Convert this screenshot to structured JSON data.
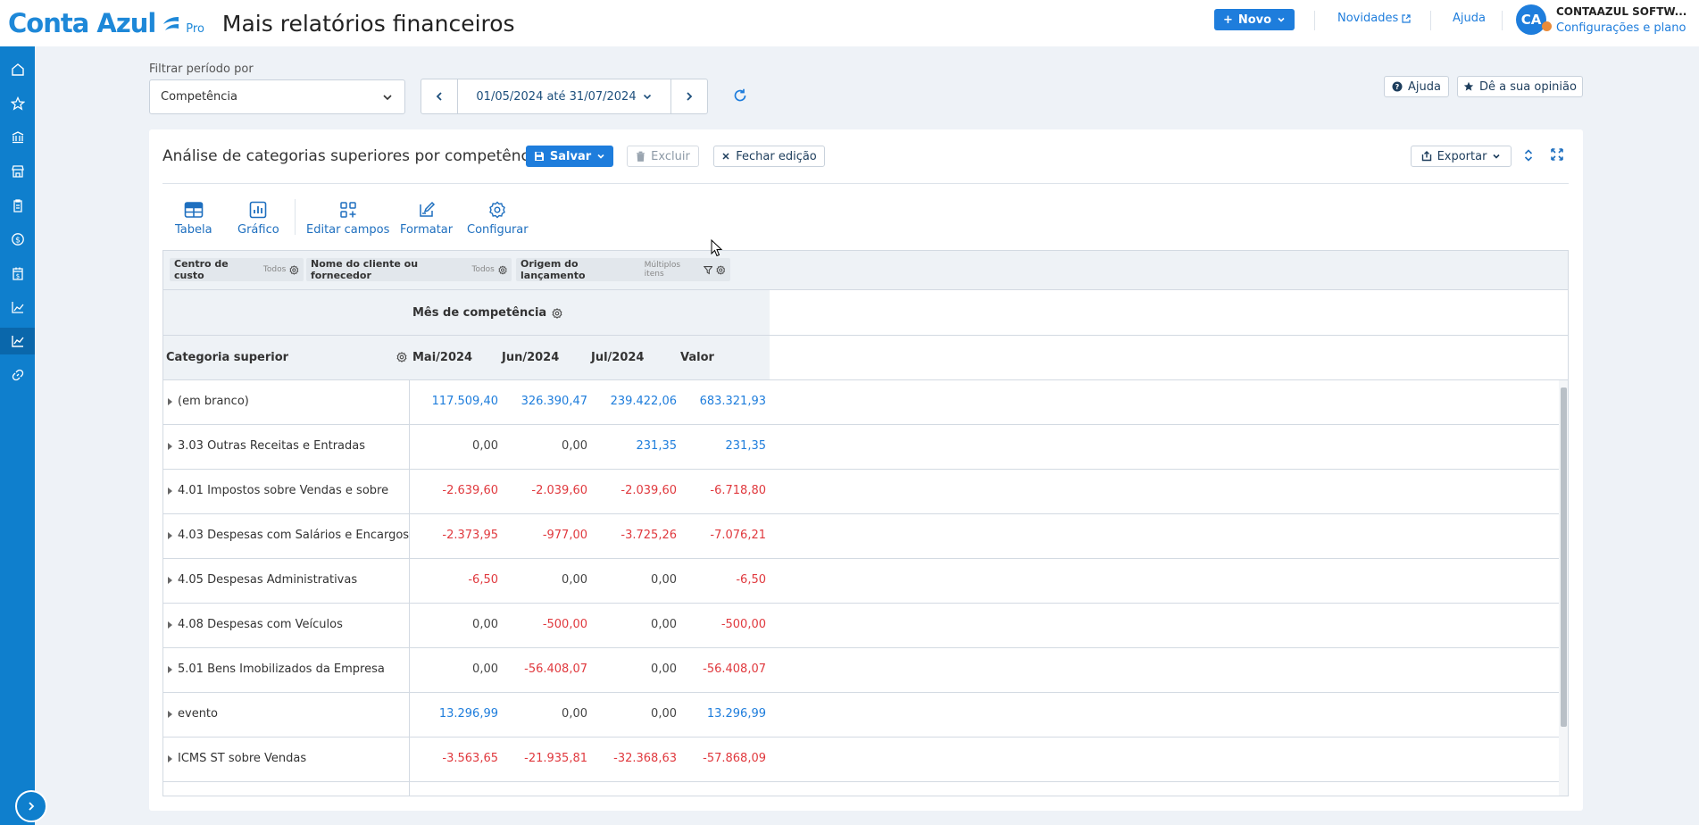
{
  "app": {
    "logo_text": "Conta Azul",
    "logo_badge": "Pro",
    "page_title": "Mais relatórios financeiros"
  },
  "topbar": {
    "new_label": "Novo",
    "news_label": "Novidades",
    "help_label": "Ajuda",
    "avatar_initials": "CA",
    "company_name": "CONTAAZUL SOFTW...",
    "config_label": "Configurações e plano"
  },
  "sidebar": {
    "items": [
      "home-icon",
      "star-icon",
      "bank-icon",
      "store-icon",
      "clipboard-icon",
      "money-icon",
      "calendar-money-icon",
      "report-icon",
      "chart-icon",
      "link-icon"
    ],
    "active_item": "chart-icon"
  },
  "filters": {
    "period_label": "Filtrar período por",
    "period_type": "Competência",
    "date_range": "01/05/2024 até 31/07/2024",
    "help_button": "Ajuda",
    "feedback_button": "Dê a sua opinião"
  },
  "report": {
    "title": "Análise de categorias superiores por competência",
    "save_label": "Salvar",
    "delete_label": "Excluir",
    "close_edit_label": "Fechar edição",
    "export_label": "Exportar",
    "tools": [
      "Tabela",
      "Gráfico",
      "Editar campos",
      "Formatar",
      "Configurar"
    ],
    "filter_chips": [
      {
        "name": "Centro de custo",
        "value": "Todos"
      },
      {
        "name": "Nome do cliente ou fornecedor",
        "value": "Todos"
      },
      {
        "name": "Origem do lançamento",
        "value": "Múltiplos itens"
      }
    ],
    "column_group_header": "Mês de competência",
    "row_header": "Categoria superior",
    "columns": [
      "Mai/2024",
      "Jun/2024",
      "Jul/2024",
      "Valor"
    ],
    "rows": [
      {
        "category": "(em branco)",
        "values": [
          "117.509,40",
          "326.390,47",
          "239.422,06",
          "683.321,93"
        ]
      },
      {
        "category": "3.03 Outras Receitas e Entradas",
        "values": [
          "0,00",
          "0,00",
          "231,35",
          "231,35"
        ]
      },
      {
        "category": "4.01 Impostos sobre Vendas e sobre",
        "values": [
          "-2.639,60",
          "-2.039,60",
          "-2.039,60",
          "-6.718,80"
        ]
      },
      {
        "category": "4.03 Despesas com Salários e Encargos",
        "values": [
          "-2.373,95",
          "-977,00",
          "-3.725,26",
          "-7.076,21"
        ]
      },
      {
        "category": "4.05 Despesas Administrativas",
        "values": [
          "-6,50",
          "0,00",
          "0,00",
          "-6,50"
        ]
      },
      {
        "category": "4.08 Despesas com Veículos",
        "values": [
          "0,00",
          "-500,00",
          "0,00",
          "-500,00"
        ]
      },
      {
        "category": "5.01 Bens Imobilizados da Empresa",
        "values": [
          "0,00",
          "-56.408,07",
          "0,00",
          "-56.408,07"
        ]
      },
      {
        "category": "evento",
        "values": [
          "13.296,99",
          "0,00",
          "0,00",
          "13.296,99"
        ]
      },
      {
        "category": "ICMS ST sobre Vendas",
        "values": [
          "-3.563,65",
          "-21.935,81",
          "-32.368,63",
          "-57.868,09"
        ]
      }
    ]
  },
  "colors": {
    "brand": "#1e88d8",
    "primary_button": "#1e7ddc",
    "sidebar": "#0f7fcd",
    "positive_value": "#1e7ddc",
    "negative_value": "#e0393e"
  }
}
